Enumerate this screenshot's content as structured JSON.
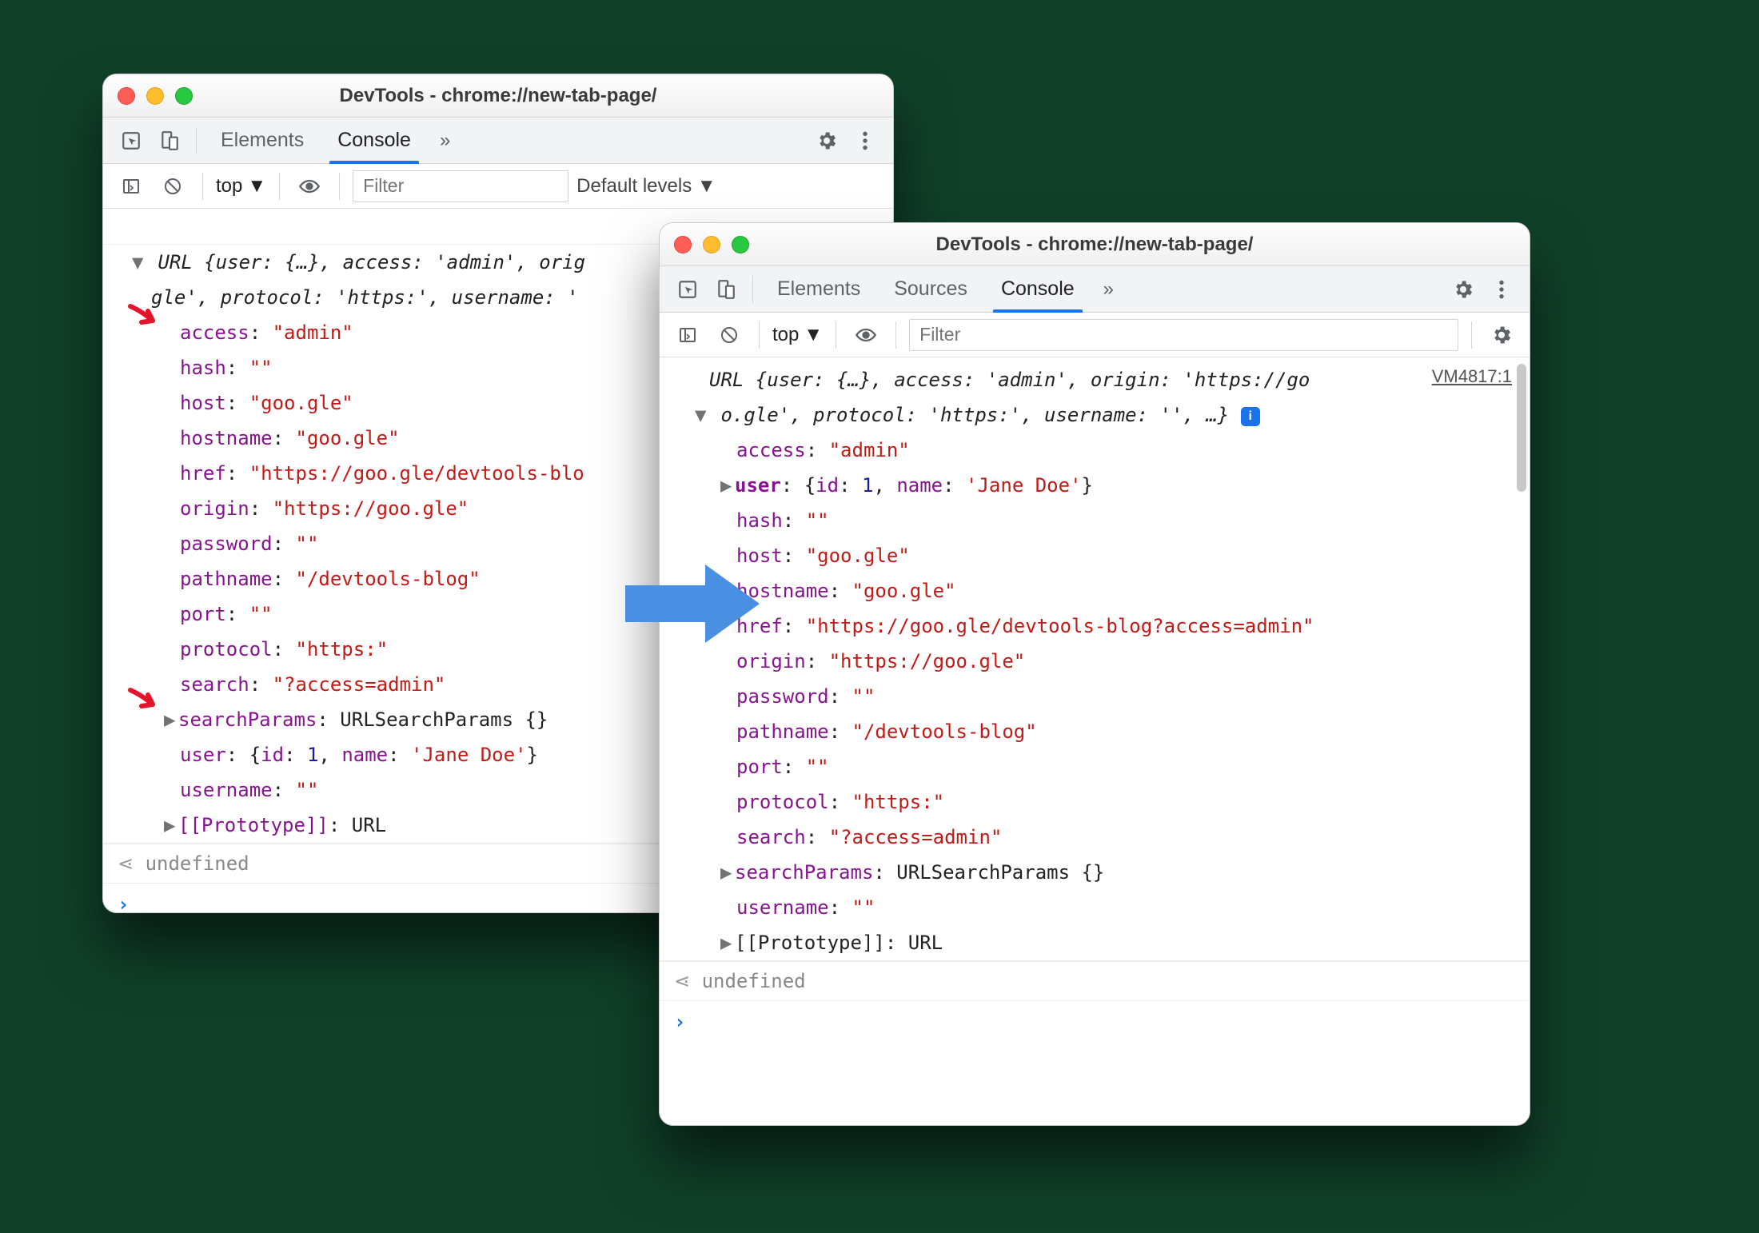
{
  "win1": {
    "title": "DevTools - chrome://new-tab-page/",
    "tabs": {
      "elements": "Elements",
      "console": "Console"
    },
    "context": "top",
    "filter_placeholder": "Filter",
    "levels": "Default levels",
    "cutoff_code": "",
    "summary_line1": "URL {user: {…}, access: 'admin', orig",
    "summary_line2": "gle', protocol: 'https:', username: '",
    "props": {
      "access": {
        "k": "access",
        "v": "\"admin\""
      },
      "hash": {
        "k": "hash",
        "v": "\"\""
      },
      "host": {
        "k": "host",
        "v": "\"goo.gle\""
      },
      "hostname": {
        "k": "hostname",
        "v": "\"goo.gle\""
      },
      "href": {
        "k": "href",
        "v": "\"https://goo.gle/devtools-blo"
      },
      "origin": {
        "k": "origin",
        "v": "\"https://goo.gle\""
      },
      "password": {
        "k": "password",
        "v": "\"\""
      },
      "pathname": {
        "k": "pathname",
        "v": "\"/devtools-blog\""
      },
      "port": {
        "k": "port",
        "v": "\"\""
      },
      "protocol": {
        "k": "protocol",
        "v": "\"https:\""
      },
      "search": {
        "k": "search",
        "v": "\"?access=admin\""
      },
      "searchParams": {
        "k": "searchParams",
        "v": "URLSearchParams {}"
      },
      "user": {
        "k": "user",
        "pre": "{",
        "id_k": "id",
        "id_v": "1",
        "name_k": "name",
        "name_v": "'Jane Doe'",
        "post": "}"
      },
      "username": {
        "k": "username",
        "v": "\"\""
      },
      "proto": {
        "k": "[[Prototype]]",
        "v": "URL"
      }
    },
    "undefined": "undefined"
  },
  "win2": {
    "title": "DevTools - chrome://new-tab-page/",
    "tabs": {
      "elements": "Elements",
      "sources": "Sources",
      "console": "Console"
    },
    "context": "top",
    "filter_placeholder": "Filter",
    "source_link": "VM4817:1",
    "summary_line1": "URL {user: {…}, access: 'admin', origin: 'https://go",
    "summary_line2": "o.gle', protocol: 'https:', username: '', …}",
    "props": {
      "access": {
        "k": "access",
        "v": "\"admin\""
      },
      "user": {
        "k": "user",
        "pre": "{",
        "id_k": "id",
        "id_v": "1",
        "name_k": "name",
        "name_v": "'Jane Doe'",
        "post": "}"
      },
      "hash": {
        "k": "hash",
        "v": "\"\""
      },
      "host": {
        "k": "host",
        "v": "\"goo.gle\""
      },
      "hostname": {
        "k": "hostname",
        "v": "\"goo.gle\""
      },
      "href": {
        "k": "href",
        "v": "\"https://goo.gle/devtools-blog?access=admin\""
      },
      "origin": {
        "k": "origin",
        "v": "\"https://goo.gle\""
      },
      "password": {
        "k": "password",
        "v": "\"\""
      },
      "pathname": {
        "k": "pathname",
        "v": "\"/devtools-blog\""
      },
      "port": {
        "k": "port",
        "v": "\"\""
      },
      "protocol": {
        "k": "protocol",
        "v": "\"https:\""
      },
      "search": {
        "k": "search",
        "v": "\"?access=admin\""
      },
      "searchParams": {
        "k": "searchParams",
        "v": "URLSearchParams {}"
      },
      "username": {
        "k": "username",
        "v": "\"\""
      },
      "proto": {
        "k": "[[Prototype]]",
        "v": "URL"
      }
    },
    "undefined": "undefined"
  }
}
